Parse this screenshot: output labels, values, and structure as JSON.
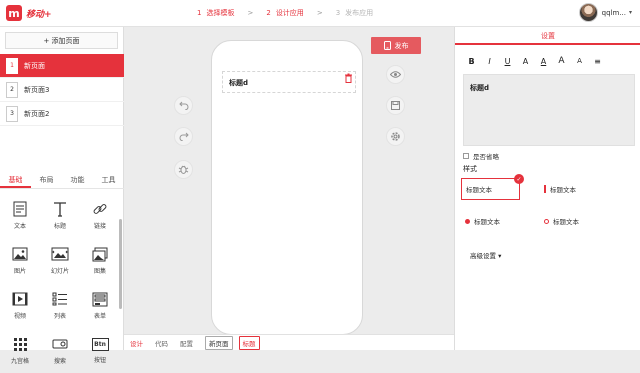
{
  "app": {
    "logo_mark": "m",
    "logo_name": "移动+"
  },
  "steps": [
    {
      "num": "1",
      "label": "选择模板"
    },
    {
      "num": "2",
      "label": "设计应用"
    },
    {
      "num": "3",
      "label": "发布应用"
    }
  ],
  "step_separator": ">",
  "user": {
    "name": "qqlm..."
  },
  "left": {
    "add_page": "+ 添加页面",
    "pages": [
      {
        "num": "1",
        "label": "新页面"
      },
      {
        "num": "2",
        "label": "新页面3"
      },
      {
        "num": "3",
        "label": "新页面2"
      }
    ],
    "tabs": [
      "基础",
      "布局",
      "功能",
      "工具"
    ],
    "components": [
      {
        "label": "文本",
        "icon": "text-doc-icon"
      },
      {
        "label": "标题",
        "icon": "title-t-icon"
      },
      {
        "label": "链接",
        "icon": "link-icon"
      },
      {
        "label": "图片",
        "icon": "image-icon"
      },
      {
        "label": "幻灯片",
        "icon": "slideshow-icon"
      },
      {
        "label": "图集",
        "icon": "gallery-icon"
      },
      {
        "label": "视频",
        "icon": "video-icon"
      },
      {
        "label": "列表",
        "icon": "list-icon"
      },
      {
        "label": "表单",
        "icon": "form-icon"
      },
      {
        "label": "九宫格",
        "icon": "grid-icon"
      },
      {
        "label": "搜索",
        "icon": "search-icon"
      },
      {
        "label": "按钮",
        "icon": "button-icon",
        "text": "Btn"
      }
    ]
  },
  "canvas": {
    "widget_title": "标题d",
    "publish": "发布"
  },
  "bottom": {
    "tabs": [
      "设计",
      "代码",
      "配置"
    ],
    "chips": [
      "新页面",
      "标题"
    ]
  },
  "right": {
    "tab": "设置",
    "format_buttons": [
      "B",
      "I",
      "U",
      "A",
      "A",
      "A",
      "A",
      "≡"
    ],
    "text_value": "标题d",
    "omit_label": "是否省略",
    "style_label": "样式",
    "styles": [
      "标题文本",
      "标题文本",
      "标题文本",
      "标题文本"
    ],
    "advanced": "高级设置"
  },
  "colors": {
    "accent": "#e5323c"
  }
}
